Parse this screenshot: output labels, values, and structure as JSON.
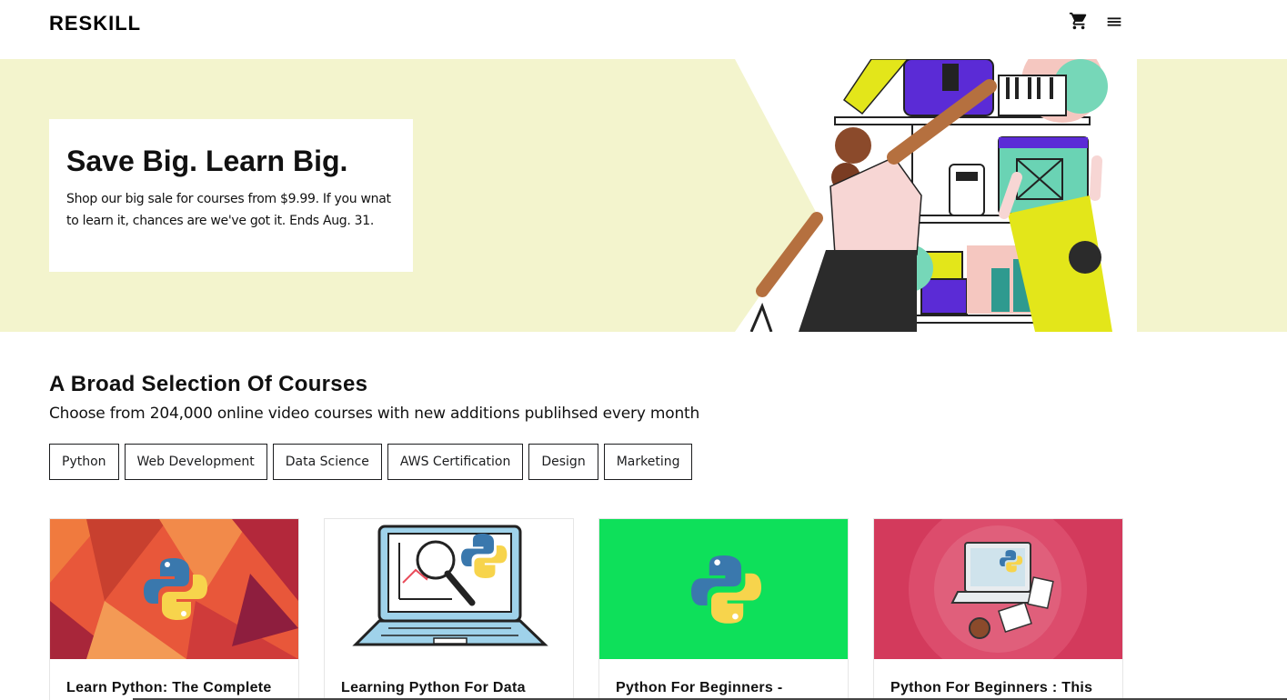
{
  "brand": {
    "name": "RESKILL"
  },
  "header": {
    "cart_icon": "shopping-cart-icon",
    "menu_icon": "hamburger-menu-icon"
  },
  "hero": {
    "title": "Save Big. Learn Big.",
    "text": "Shop our big sale for courses from $9.99. If you wnat to learn it, chances are we've got it. Ends Aug. 31.",
    "background": "#f3f4cd"
  },
  "section": {
    "title": "A Broad Selection Of Courses",
    "subtitle": "Choose from 204,000 online video courses with new additions publihsed every month"
  },
  "categories": [
    "Python",
    "Web Development",
    "Data Science",
    "AWS Certification",
    "Design",
    "Marketing"
  ],
  "courses": [
    {
      "title": "Learn Python: The Complete",
      "thumb_color": "#e8573a"
    },
    {
      "title": "Learning Python For Data",
      "thumb_color": "#ffffff"
    },
    {
      "title": "Python For Beginners -",
      "thumb_color": "#0ee05a"
    },
    {
      "title": "Python For Beginners : This",
      "thumb_color": "#d33a5c"
    }
  ]
}
